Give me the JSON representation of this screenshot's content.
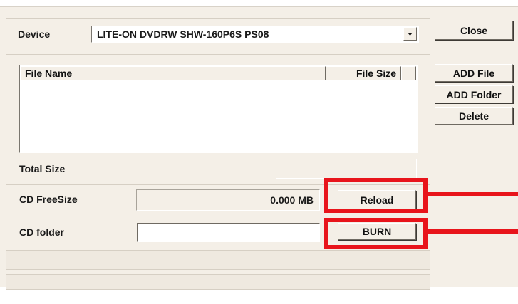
{
  "device": {
    "label": "Device",
    "selected": "LITE-ON DVDRW SHW-160P6S PS08"
  },
  "buttons": {
    "close": "Close",
    "add_file": "ADD File",
    "add_folder": "ADD Folder",
    "delete": "Delete",
    "reload": "Reload",
    "burn": "BURN"
  },
  "file_list": {
    "columns": [
      "File Name",
      "File Size"
    ],
    "rows": []
  },
  "total_size": {
    "label": "Total Size",
    "value": ""
  },
  "cd_freesize": {
    "label": "CD FreeSize",
    "value": "0.000 MB"
  },
  "cd_folder": {
    "label": "CD folder",
    "value": ""
  },
  "status_bar": {
    "line1": "",
    "line2": ""
  },
  "colors": {
    "window_bg": "#f4efe7",
    "highlight_red": "#e8141b"
  }
}
